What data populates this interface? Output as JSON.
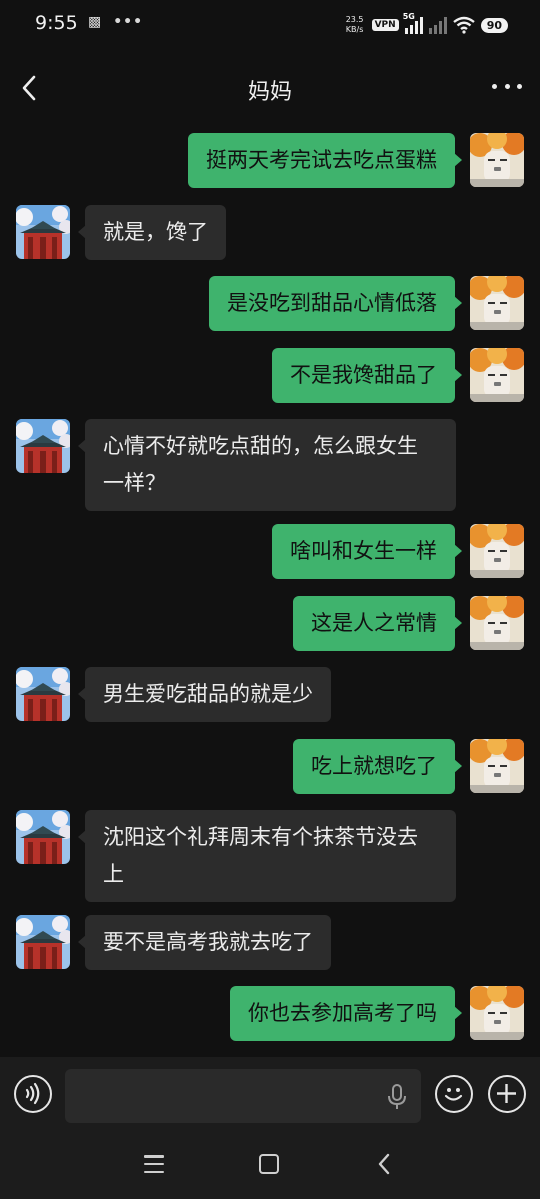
{
  "status_bar": {
    "time": "9:55",
    "net_speed_value": "23.5",
    "net_speed_unit": "KB/s",
    "vpn": "VPN",
    "signal_tag": "5G",
    "battery": "90",
    "icons": [
      "sim-icon",
      "more-dots-icon",
      "signal-icon",
      "wifi-icon",
      "battery-icon"
    ]
  },
  "header": {
    "title": "妈妈",
    "icons": [
      "back-icon",
      "more-icon"
    ]
  },
  "messages": [
    {
      "side": "sent",
      "text": "挺两天考完试去吃点蛋糕"
    },
    {
      "side": "received",
      "text": "就是，馋了"
    },
    {
      "side": "sent",
      "text": "是没吃到甜品心情低落"
    },
    {
      "side": "sent",
      "text": "不是我馋甜品了"
    },
    {
      "side": "received",
      "text": "心情不好就吃点甜的，怎么跟女生一样？"
    },
    {
      "side": "sent",
      "text": "啥叫和女生一样"
    },
    {
      "side": "sent",
      "text": "这是人之常情"
    },
    {
      "side": "received",
      "text": "男生爱吃甜品的就是少"
    },
    {
      "side": "sent",
      "text": "吃上就想吃了"
    },
    {
      "side": "received",
      "text": "沈阳这个礼拜周末有个抹茶节没去上"
    },
    {
      "side": "received",
      "text": "要不是高考我就去吃了"
    },
    {
      "side": "sent",
      "text": "你也去参加高考了吗"
    }
  ],
  "input_bar": {
    "value": "",
    "icons": [
      "voice-icon",
      "mic-icon",
      "emoji-icon",
      "plus-icon"
    ]
  },
  "colors": {
    "background": "#111111",
    "sent_bubble": "#3fb36d",
    "received_bubble": "#2c2c2c"
  }
}
